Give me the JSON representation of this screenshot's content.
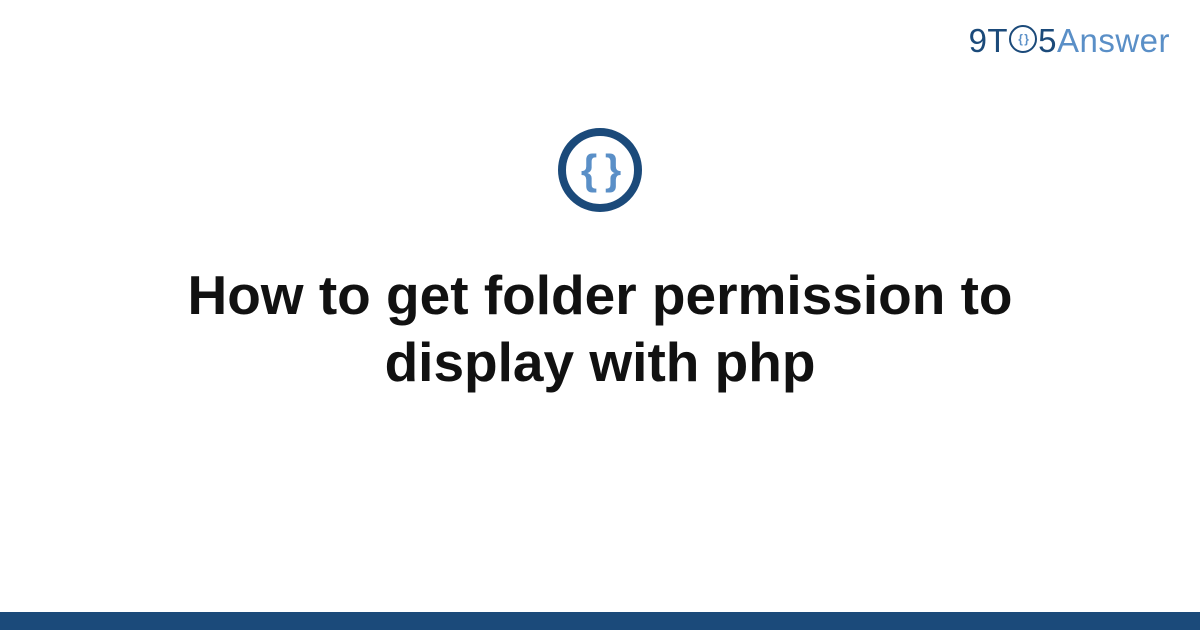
{
  "logo": {
    "part1": "9T",
    "circle_inner": "{ }",
    "part2": "5",
    "part3": "Answer"
  },
  "icon": {
    "braces": "{ }"
  },
  "title": "How to get folder permission to display with php"
}
